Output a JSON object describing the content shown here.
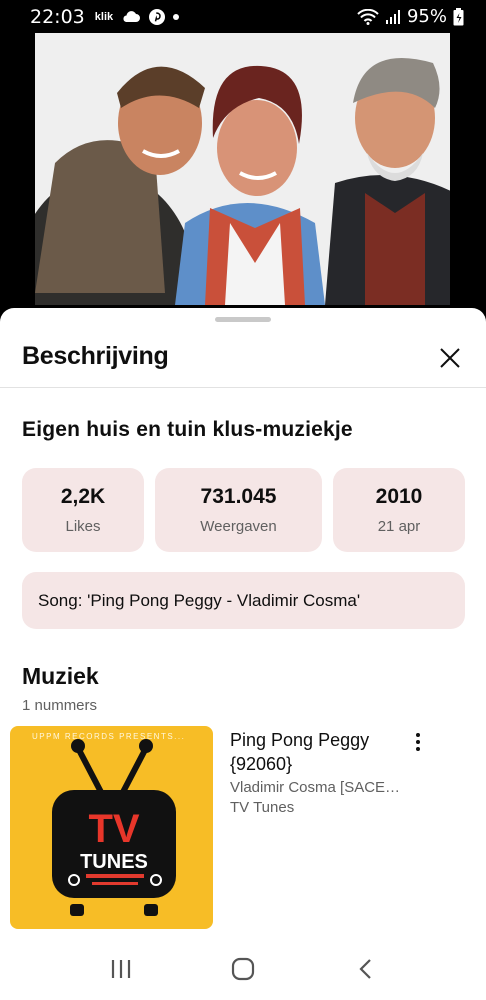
{
  "status_bar": {
    "time": "22:03",
    "left_icons": [
      "klik-icon",
      "cloud-icon",
      "pinterest-icon",
      "dot-icon"
    ],
    "klik_text": "klik",
    "battery": "95%"
  },
  "video": {
    "progress_fraction": 0.31,
    "progress_color": "#ff0033"
  },
  "sheet": {
    "title": "Beschrijving",
    "video_title": "Eigen huis en tuin klus-muziekje",
    "stats": [
      {
        "value": "2,2K",
        "label": "Likes"
      },
      {
        "value": "731.045",
        "label": "Weergaven"
      },
      {
        "value": "2010",
        "label": "21 apr"
      }
    ],
    "description": "Song: 'Ping Pong Peggy - Vladimir Cosma'",
    "music": {
      "title": "Muziek",
      "count": "1 nummers",
      "tracks": [
        {
          "title": "Ping Pong Peggy {92060}",
          "artist": "Vladimir Cosma [SACE…",
          "album": "TV Tunes",
          "thumb_top": "UPPM RECORDS PRESENTS...",
          "thumb_logo_line1": "TV",
          "thumb_logo_line2": "TUNES"
        }
      ]
    }
  },
  "colors": {
    "accent": "#ff0033",
    "chip_bg": "#f5e6e6",
    "album_bg": "#f7bd26"
  }
}
